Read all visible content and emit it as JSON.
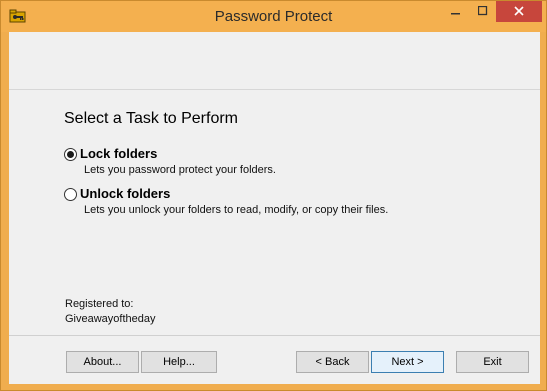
{
  "window": {
    "title": "Password Protect",
    "accent_color": "#f4b04f",
    "close_color": "#c7463c"
  },
  "icons": {
    "app": "folder-key-icon",
    "minimize": "minimize-icon",
    "maximize": "maximize-icon",
    "close": "close-icon"
  },
  "wizard": {
    "heading": "Select a Task to Perform",
    "options": [
      {
        "label": "Lock folders",
        "description": "Lets you password protect your folders.",
        "selected": true
      },
      {
        "label": "Unlock folders",
        "description": "Lets you unlock your folders to read, modify, or copy their files.",
        "selected": false
      }
    ],
    "registration": {
      "label": "Registered to:",
      "name": "Giveawayoftheday"
    }
  },
  "buttons": {
    "about": "About...",
    "help": "Help...",
    "back": "< Back",
    "next": "Next >",
    "exit": "Exit"
  }
}
